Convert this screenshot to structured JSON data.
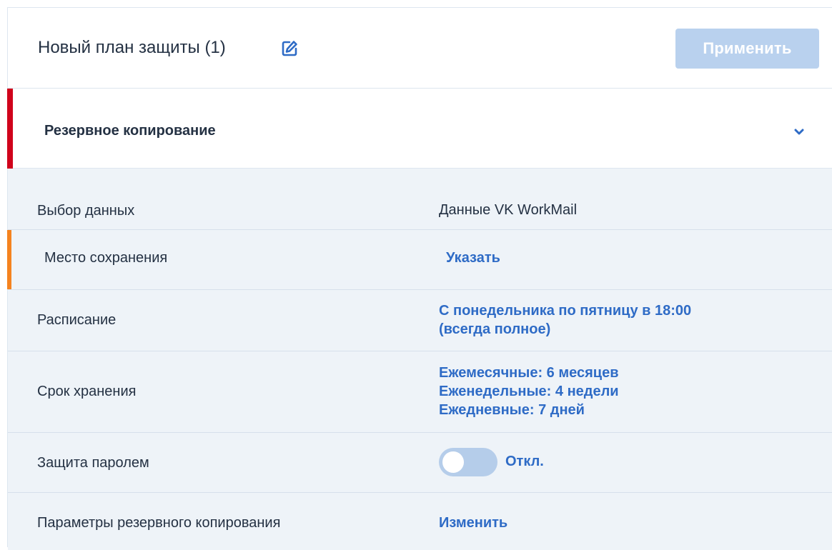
{
  "header": {
    "plan_title": "Новый план защиты (1)",
    "edit_icon": "edit-icon",
    "apply_label": "Применить"
  },
  "section": {
    "title": "Резервное копирование",
    "chevron_icon": "chevron-down-icon",
    "accent_color": "#d0021b"
  },
  "rows": {
    "data_selection": {
      "label": "Выбор данных",
      "value": "Данные VK WorkMail"
    },
    "storage": {
      "label": "Место сохранения",
      "value": "Указать",
      "warning_color": "#f5831f"
    },
    "schedule": {
      "label": "Расписание",
      "value_line1": "С понедельника по пятницу в 18:00",
      "value_line2": "(всегда полное)"
    },
    "retention": {
      "label": "Срок хранения",
      "value_line1": "Ежемесячные: 6 месяцев",
      "value_line2": "Еженедельные: 4 недели",
      "value_line3": "Ежедневные: 7 дней"
    },
    "password": {
      "label": "Защита паролем",
      "toggle_state": "off",
      "toggle_text": "Откл."
    },
    "backup_options": {
      "label": "Параметры резервного копирования",
      "value": "Изменить"
    }
  },
  "colors": {
    "link": "#2e6bc6",
    "apply_disabled": "#b9d1ee",
    "row_background": "#eef3f8"
  }
}
